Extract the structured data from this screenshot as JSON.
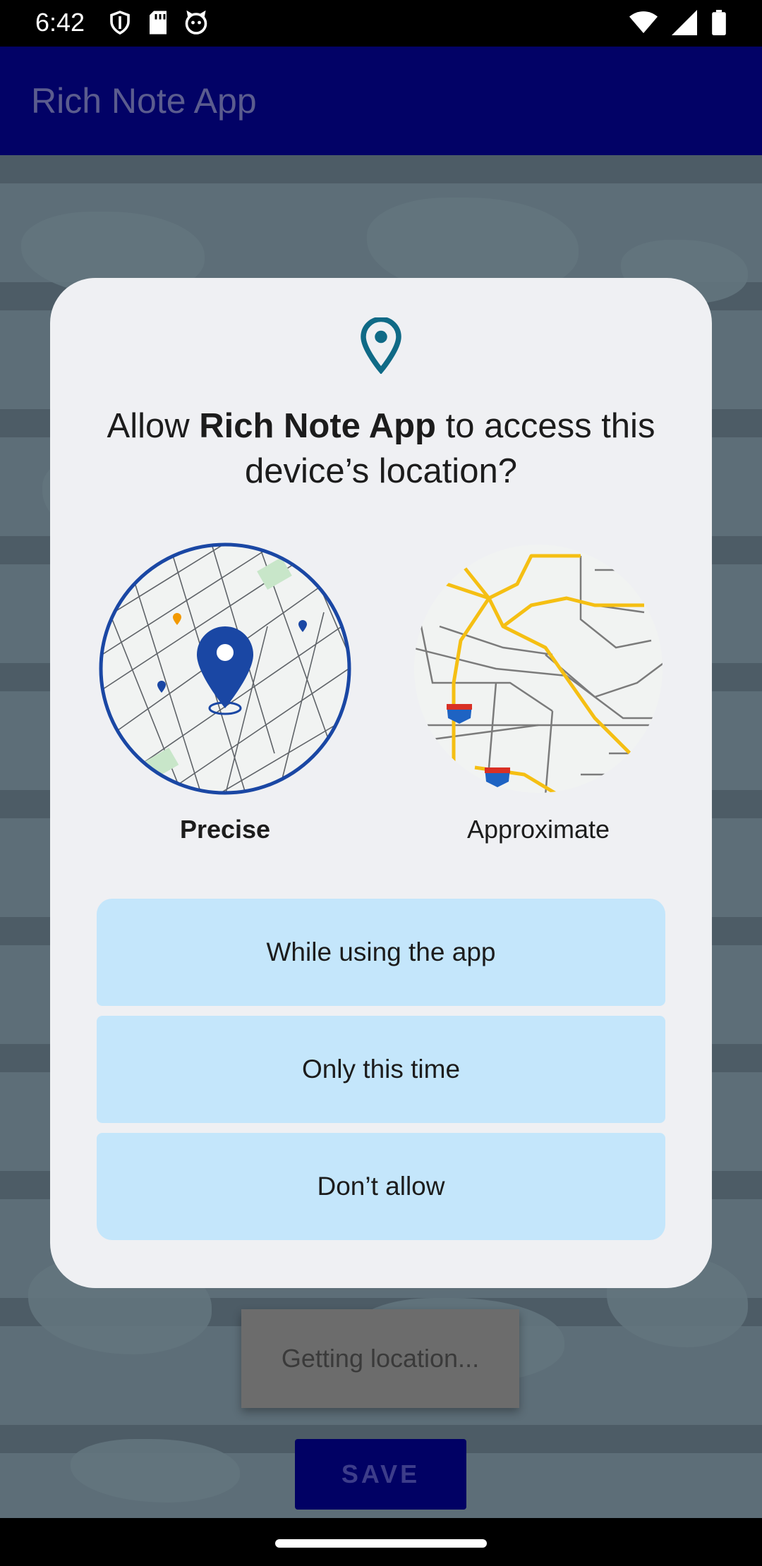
{
  "status_bar": {
    "time": "6:42",
    "left_icons": [
      "shield-icon",
      "sd-card-icon",
      "cat-icon"
    ],
    "right_icons": [
      "wifi-icon",
      "signal-icon",
      "battery-icon"
    ]
  },
  "app": {
    "title": "Rich Note App",
    "getting_location_label": "Getting location...",
    "save_label": "SAVE",
    "colors": {
      "appbar": "#020266",
      "save_button": "#010164"
    }
  },
  "dialog": {
    "icon": "location-pin-icon",
    "title_prefix": "Allow ",
    "title_app": "Rich Note App",
    "title_suffix": " to access this device’s location?",
    "precise_label": "Precise",
    "approximate_label": "Approximate",
    "selected_option": "Precise",
    "buttons": {
      "while_using": "While using the app",
      "only_this_time": "Only this time",
      "dont_allow": "Don’t allow"
    },
    "colors": {
      "background": "#eff0f3",
      "button": "#c4e6fb",
      "accent": "#1a47a4",
      "road": "#f5bf13"
    }
  }
}
